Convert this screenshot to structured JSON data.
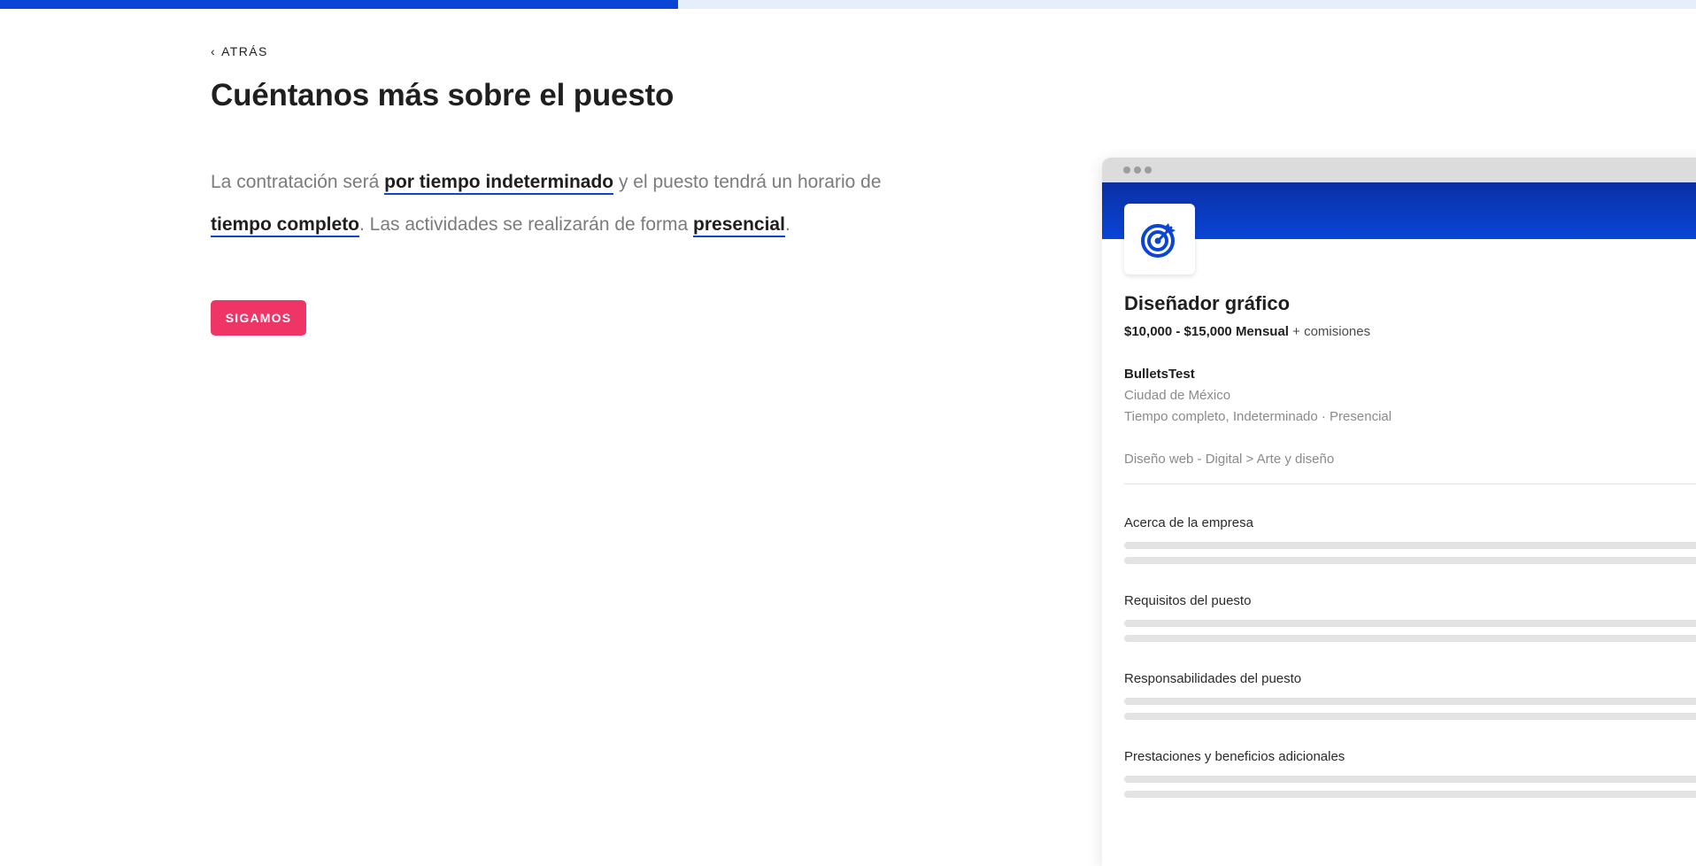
{
  "progress": {
    "fraction": 0.4
  },
  "nav": {
    "back_label": "ATRÁS",
    "back_icon": "chevron-left-icon"
  },
  "heading": {
    "title": "Cuéntanos más sobre el puesto"
  },
  "sentence": {
    "part1": "La contratación será ",
    "contract_type": "por tiempo indeterminado",
    "part2": " y el puesto tendrá un horario de ",
    "schedule": "tiempo completo",
    "part3": ". Las actividades se realizarán de forma ",
    "modality": "presencial",
    "part4": "."
  },
  "cta": {
    "label": "SIGAMOS"
  },
  "colors": {
    "accent": "#0a45d6",
    "cta": "#ef3466",
    "progress_track": "#e6eefc"
  },
  "preview": {
    "logo_icon": "target-icon",
    "job_title": "Diseñador gráfico",
    "salary": "$10,000 - $15,000 Mensual",
    "salary_extra": " + comisiones",
    "company": "BulletsTest",
    "location": "Ciudad de México",
    "employment": "Tiempo completo, Indeterminado · Presencial",
    "category": "Diseño web - Digital > Arte y diseño",
    "sections": [
      {
        "title": "Acerca de la empresa"
      },
      {
        "title": "Requisitos del puesto"
      },
      {
        "title": "Responsabilidades del puesto"
      },
      {
        "title": "Prestaciones y beneficios adicionales"
      }
    ]
  }
}
